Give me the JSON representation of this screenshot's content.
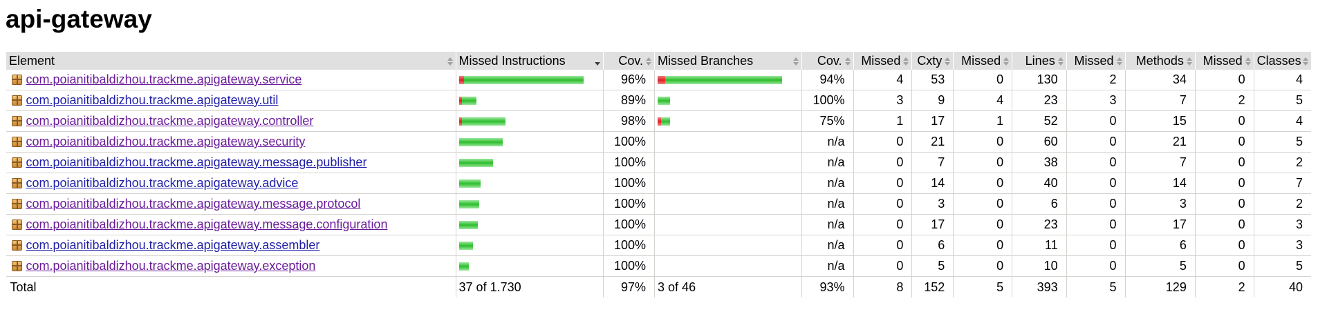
{
  "page": {
    "title": "api-gateway"
  },
  "table": {
    "headers": {
      "element": "Element",
      "missed_instructions": "Missed Instructions",
      "instr_cov": "Cov.",
      "missed_branches": "Missed Branches",
      "branch_cov": "Cov.",
      "cxty_missed": "Missed",
      "cxty": "Cxty",
      "lines_missed": "Missed",
      "lines": "Lines",
      "methods_missed": "Missed",
      "methods": "Methods",
      "classes_missed": "Missed",
      "classes": "Classes"
    },
    "sorted_column": "missed_instructions",
    "rows": [
      {
        "name": "com.poianitibaldizhou.trackme.apigateway.service",
        "visited": true,
        "instr_missed_frac": 0.04,
        "instr_total_frac": 1.0,
        "instr_cov": "96%",
        "br_missed_frac": 0.06,
        "br_total_frac": 1.0,
        "br_cov": "94%",
        "cxty_missed": "4",
        "cxty": "53",
        "lines_missed": "0",
        "lines": "130",
        "methods_missed": "2",
        "methods": "34",
        "classes_missed": "0",
        "classes": "4"
      },
      {
        "name": "com.poianitibaldizhou.trackme.apigateway.util",
        "visited": false,
        "instr_missed_frac": 0.11,
        "instr_total_frac": 0.14,
        "instr_cov": "89%",
        "br_missed_frac": 0.0,
        "br_total_frac": 0.1,
        "br_cov": "100%",
        "cxty_missed": "3",
        "cxty": "9",
        "lines_missed": "4",
        "lines": "23",
        "methods_missed": "3",
        "methods": "7",
        "classes_missed": "2",
        "classes": "5"
      },
      {
        "name": "com.poianitibaldizhou.trackme.apigateway.controller",
        "visited": true,
        "instr_missed_frac": 0.02,
        "instr_total_frac": 0.37,
        "instr_cov": "98%",
        "br_missed_frac": 0.25,
        "br_total_frac": 0.1,
        "br_cov": "75%",
        "cxty_missed": "1",
        "cxty": "17",
        "lines_missed": "1",
        "lines": "52",
        "methods_missed": "0",
        "methods": "15",
        "classes_missed": "0",
        "classes": "4"
      },
      {
        "name": "com.poianitibaldizhou.trackme.apigateway.security",
        "visited": true,
        "instr_missed_frac": 0.0,
        "instr_total_frac": 0.35,
        "instr_cov": "100%",
        "br_missed_frac": null,
        "br_total_frac": 0,
        "br_cov": "n/a",
        "cxty_missed": "0",
        "cxty": "21",
        "lines_missed": "0",
        "lines": "60",
        "methods_missed": "0",
        "methods": "21",
        "classes_missed": "0",
        "classes": "5"
      },
      {
        "name": "com.poianitibaldizhou.trackme.apigateway.message.publisher",
        "visited": false,
        "instr_missed_frac": 0.0,
        "instr_total_frac": 0.27,
        "instr_cov": "100%",
        "br_missed_frac": null,
        "br_total_frac": 0,
        "br_cov": "n/a",
        "cxty_missed": "0",
        "cxty": "7",
        "lines_missed": "0",
        "lines": "38",
        "methods_missed": "0",
        "methods": "7",
        "classes_missed": "0",
        "classes": "2"
      },
      {
        "name": "com.poianitibaldizhou.trackme.apigateway.advice",
        "visited": false,
        "instr_missed_frac": 0.0,
        "instr_total_frac": 0.17,
        "instr_cov": "100%",
        "br_missed_frac": null,
        "br_total_frac": 0,
        "br_cov": "n/a",
        "cxty_missed": "0",
        "cxty": "14",
        "lines_missed": "0",
        "lines": "40",
        "methods_missed": "0",
        "methods": "14",
        "classes_missed": "0",
        "classes": "7"
      },
      {
        "name": "com.poianitibaldizhou.trackme.apigateway.message.protocol",
        "visited": true,
        "instr_missed_frac": 0.0,
        "instr_total_frac": 0.16,
        "instr_cov": "100%",
        "br_missed_frac": null,
        "br_total_frac": 0,
        "br_cov": "n/a",
        "cxty_missed": "0",
        "cxty": "3",
        "lines_missed": "0",
        "lines": "6",
        "methods_missed": "0",
        "methods": "3",
        "classes_missed": "0",
        "classes": "2"
      },
      {
        "name": "com.poianitibaldizhou.trackme.apigateway.message.configuration",
        "visited": true,
        "instr_missed_frac": 0.0,
        "instr_total_frac": 0.15,
        "instr_cov": "100%",
        "br_missed_frac": null,
        "br_total_frac": 0,
        "br_cov": "n/a",
        "cxty_missed": "0",
        "cxty": "17",
        "lines_missed": "0",
        "lines": "23",
        "methods_missed": "0",
        "methods": "17",
        "classes_missed": "0",
        "classes": "3"
      },
      {
        "name": "com.poianitibaldizhou.trackme.apigateway.assembler",
        "visited": false,
        "instr_missed_frac": 0.0,
        "instr_total_frac": 0.11,
        "instr_cov": "100%",
        "br_missed_frac": null,
        "br_total_frac": 0,
        "br_cov": "n/a",
        "cxty_missed": "0",
        "cxty": "6",
        "lines_missed": "0",
        "lines": "11",
        "methods_missed": "0",
        "methods": "6",
        "classes_missed": "0",
        "classes": "3"
      },
      {
        "name": "com.poianitibaldizhou.trackme.apigateway.exception",
        "visited": true,
        "instr_missed_frac": 0.0,
        "instr_total_frac": 0.08,
        "instr_cov": "100%",
        "br_missed_frac": null,
        "br_total_frac": 0,
        "br_cov": "n/a",
        "cxty_missed": "0",
        "cxty": "5",
        "lines_missed": "0",
        "lines": "10",
        "methods_missed": "0",
        "methods": "5",
        "classes_missed": "0",
        "classes": "5"
      }
    ],
    "total": {
      "label": "Total",
      "instructions": "37 of 1.730",
      "instr_cov": "97%",
      "branches": "3 of 46",
      "br_cov": "93%",
      "cxty_missed": "8",
      "cxty": "152",
      "lines_missed": "5",
      "lines": "393",
      "methods_missed": "5",
      "methods": "129",
      "classes_missed": "2",
      "classes": "40"
    }
  },
  "colors": {
    "link": "#1f1fa8",
    "link_visited": "#6a1b9a",
    "bar_green": "#2dbd2d",
    "bar_red": "#e02020",
    "header_bg": "#e0e0e0"
  }
}
